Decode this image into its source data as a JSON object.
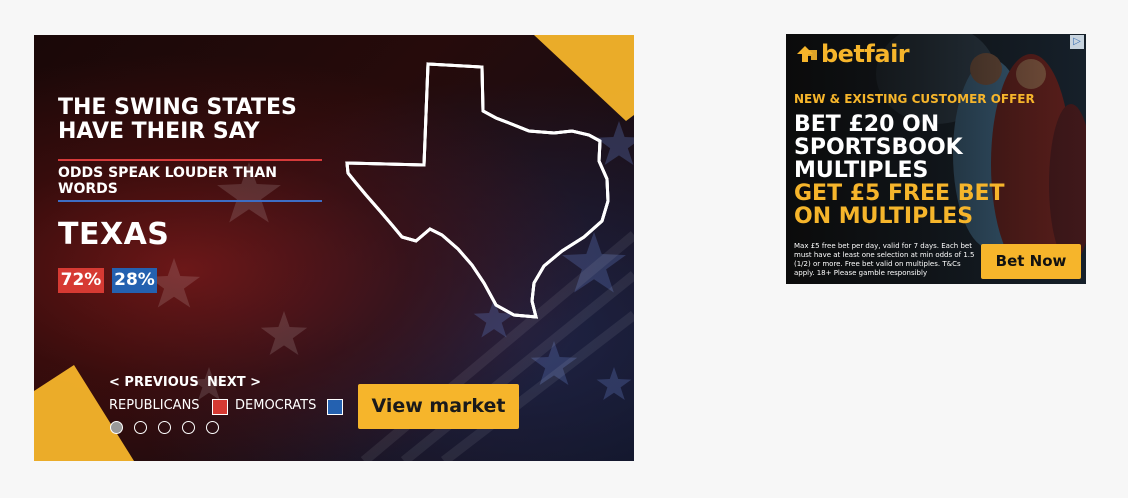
{
  "main_ad": {
    "headline_line1": "THE SWING STATES",
    "headline_line2": "HAVE THEIR SAY",
    "subheading": "ODDS SPEAK LOUDER THAN WORDS",
    "state": "TEXAS",
    "republican_pct": "72%",
    "democrat_pct": "28%",
    "prev_label": "< PREVIOUS",
    "next_label": "NEXT >",
    "legend_republicans": "REPUBLICANS",
    "legend_democrats": "DEMOCRATS",
    "cta_label": "View market",
    "colors": {
      "republican": "#d63a33",
      "democrat": "#2461b0",
      "accent": "#f6b52b"
    },
    "carousel": {
      "total": 5,
      "active_index": 0
    }
  },
  "betfair_ad": {
    "logo": "betfair",
    "offer": "NEW & EXISTING CUSTOMER OFFER",
    "line1": "BET £20 ON",
    "line2": "SPORTSBOOK",
    "line3": "MULTIPLES",
    "line4": "GET £5 FREE BET",
    "line5": "ON MULTIPLES",
    "terms": "Max £5 free bet per day, valid for 7 days. Each bet must have at least one selection at min odds of 1.5 (1/2) or more. Free bet valid on multiples. T&Cs apply. 18+ Please gamble responsibly",
    "cta_label": "Bet Now",
    "colors": {
      "brand": "#f6b52b"
    },
    "adchoices_icon": "adchoices-icon"
  }
}
